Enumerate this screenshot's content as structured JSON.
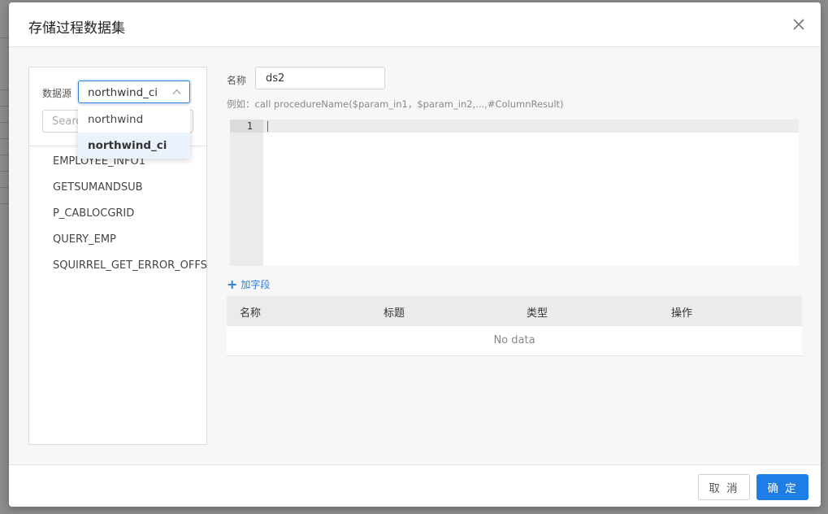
{
  "modal": {
    "title": "存储过程数据集",
    "close_icon": "close-icon"
  },
  "left": {
    "datasource_label": "数据源",
    "datasource_selected": "northwind_ci",
    "search_placeholder": "Search",
    "procedures": [
      "EMPLOYEE_INFO1",
      "GETSUMANDSUB",
      "P_CABLOCGRID",
      "QUERY_EMP",
      "SQUIRREL_GET_ERROR_OFFSET"
    ]
  },
  "dropdown": {
    "options": [
      "northwind",
      "northwind_ci"
    ],
    "selected_index": 1
  },
  "right": {
    "name_label": "名称",
    "name_value": "ds2",
    "example_text": "例如：call procedureName($param_in1，$param_in2,...,#ColumnResult)",
    "editor_line_number": "1",
    "add_field_label": "加字段",
    "table_headers": [
      "名称",
      "标题",
      "类型",
      "操作"
    ],
    "empty_text": "No data"
  },
  "footer": {
    "cancel_label": "取 消",
    "ok_label": "确 定"
  },
  "colors": {
    "primary": "#1f7ee6",
    "select_border": "#2a7fd9",
    "selected_option_bg": "#eaf3fc"
  }
}
